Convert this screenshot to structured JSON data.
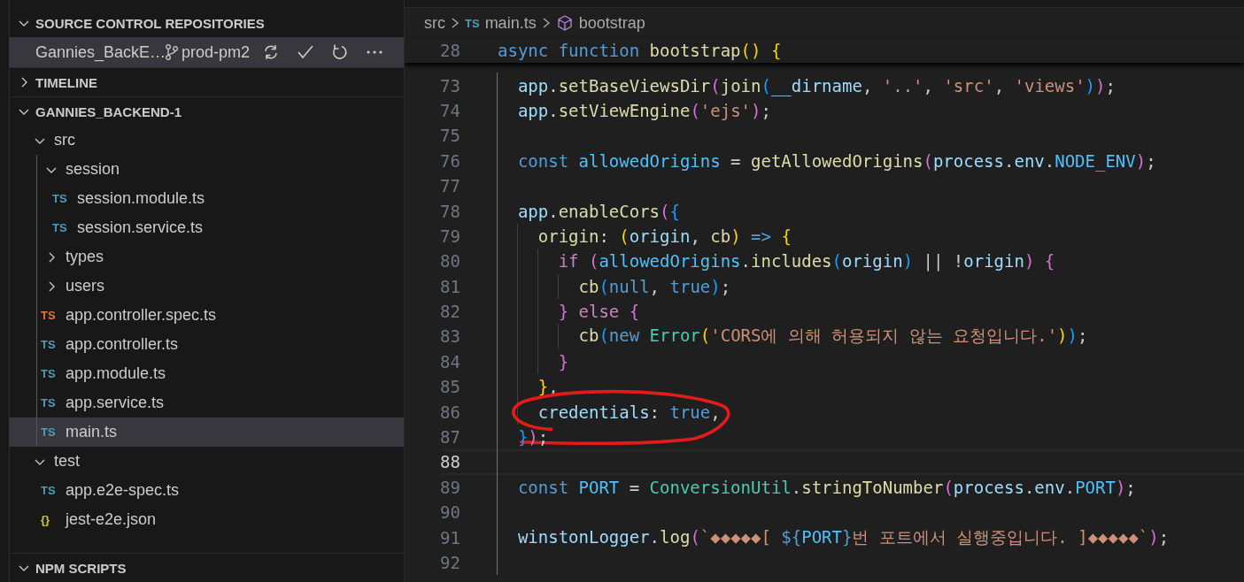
{
  "sidebar": {
    "sections": [
      {
        "kind": "repos",
        "title": "SOURCE CONTROL REPOSITORIES",
        "expanded": true,
        "repositories": [
          {
            "name": "Gannies_BackE…",
            "branch": "prod-pm2",
            "selected": true
          }
        ]
      },
      {
        "kind": "timeline",
        "title": "TIMELINE",
        "expanded": false
      },
      {
        "kind": "explorer",
        "title": "GANNIES_BACKEND-1",
        "expanded": true,
        "tree": [
          {
            "kind": "folder",
            "label": "src",
            "expanded": true,
            "selected": false,
            "children": [
              {
                "kind": "folder",
                "label": "session",
                "expanded": true,
                "selected": false,
                "children": [
                  {
                    "kind": "file",
                    "label": "session.module.ts",
                    "icon": "TS",
                    "color": "#519aba",
                    "selected": false
                  },
                  {
                    "kind": "file",
                    "label": "session.service.ts",
                    "icon": "TS",
                    "color": "#519aba",
                    "selected": false
                  }
                ]
              },
              {
                "kind": "folder",
                "label": "types",
                "expanded": false,
                "selected": false
              },
              {
                "kind": "folder",
                "label": "users",
                "expanded": false,
                "selected": false
              },
              {
                "kind": "file",
                "label": "app.controller.spec.ts",
                "icon": "TS",
                "color": "#e37933",
                "selected": false
              },
              {
                "kind": "file",
                "label": "app.controller.ts",
                "icon": "TS",
                "color": "#519aba",
                "selected": false
              },
              {
                "kind": "file",
                "label": "app.module.ts",
                "icon": "TS",
                "color": "#519aba",
                "selected": false
              },
              {
                "kind": "file",
                "label": "app.service.ts",
                "icon": "TS",
                "color": "#519aba",
                "selected": false
              },
              {
                "kind": "file",
                "label": "main.ts",
                "icon": "TS",
                "color": "#519aba",
                "selected": true
              }
            ]
          },
          {
            "kind": "folder",
            "label": "test",
            "expanded": true,
            "selected": false,
            "children": [
              {
                "kind": "file",
                "label": "app.e2e-spec.ts",
                "icon": "TS",
                "color": "#519aba",
                "selected": false
              },
              {
                "kind": "file",
                "label": "jest-e2e.json",
                "icon": "{}",
                "color": "#cbcb41",
                "selected": false
              }
            ]
          }
        ]
      },
      {
        "kind": "npm",
        "title": "NPM SCRIPTS",
        "expanded": true
      }
    ]
  },
  "editor": {
    "breadcrumb": [
      {
        "kind": "folder",
        "label": "src"
      },
      {
        "kind": "file",
        "label": "main.ts",
        "icon": "TS",
        "color": "#519aba"
      },
      {
        "kind": "symbol",
        "label": "bootstrap"
      }
    ],
    "sticky": {
      "number": "28",
      "tokens": [
        {
          "kind": "kw",
          "text": "async "
        },
        {
          "kind": "kw",
          "text": "function "
        },
        {
          "kind": "fn",
          "text": "bootstrap"
        },
        {
          "kind": "b1",
          "text": "() "
        },
        {
          "kind": "b1",
          "text": "{"
        }
      ]
    },
    "lines": [
      {
        "number": "73",
        "current": false,
        "circled": false,
        "tokens": [
          {
            "kind": "var",
            "text": "  app"
          },
          {
            "kind": "p",
            "text": "."
          },
          {
            "kind": "fn",
            "text": "setBaseViewsDir"
          },
          {
            "kind": "b2",
            "text": "("
          },
          {
            "kind": "fn",
            "text": "join"
          },
          {
            "kind": "b3",
            "text": "("
          },
          {
            "kind": "var",
            "text": "__dirname"
          },
          {
            "kind": "p",
            "text": ", "
          },
          {
            "kind": "str",
            "text": "'..'"
          },
          {
            "kind": "p",
            "text": ", "
          },
          {
            "kind": "str",
            "text": "'src'"
          },
          {
            "kind": "p",
            "text": ", "
          },
          {
            "kind": "str",
            "text": "'views'"
          },
          {
            "kind": "b3",
            "text": ")"
          },
          {
            "kind": "b2",
            "text": ")"
          },
          {
            "kind": "p",
            "text": ";"
          }
        ]
      },
      {
        "number": "74",
        "current": false,
        "circled": false,
        "tokens": [
          {
            "kind": "var",
            "text": "  app"
          },
          {
            "kind": "p",
            "text": "."
          },
          {
            "kind": "fn",
            "text": "setViewEngine"
          },
          {
            "kind": "b2",
            "text": "("
          },
          {
            "kind": "str",
            "text": "'ejs'"
          },
          {
            "kind": "b2",
            "text": ")"
          },
          {
            "kind": "p",
            "text": ";"
          }
        ]
      },
      {
        "number": "75",
        "current": false
      },
      {
        "number": "76",
        "current": false,
        "circled": false,
        "tokens": [
          {
            "kind": "kw",
            "text": "  const "
          },
          {
            "kind": "const",
            "text": "allowedOrigins"
          },
          {
            "kind": "p",
            "text": " = "
          },
          {
            "kind": "fn",
            "text": "getAllowedOrigins"
          },
          {
            "kind": "b2",
            "text": "("
          },
          {
            "kind": "var",
            "text": "process"
          },
          {
            "kind": "p",
            "text": "."
          },
          {
            "kind": "var",
            "text": "env"
          },
          {
            "kind": "p",
            "text": "."
          },
          {
            "kind": "const",
            "text": "NODE_ENV"
          },
          {
            "kind": "b2",
            "text": ")"
          },
          {
            "kind": "p",
            "text": ";"
          }
        ]
      },
      {
        "number": "77",
        "current": false
      },
      {
        "number": "78",
        "current": false,
        "circled": false,
        "tokens": [
          {
            "kind": "var",
            "text": "  app"
          },
          {
            "kind": "p",
            "text": "."
          },
          {
            "kind": "fn",
            "text": "enableCors"
          },
          {
            "kind": "b2",
            "text": "("
          },
          {
            "kind": "b3",
            "text": "{"
          }
        ]
      },
      {
        "number": "79",
        "current": false,
        "circled": false,
        "tokens": [
          {
            "kind": "fn",
            "text": "    origin"
          },
          {
            "kind": "p",
            "text": ": "
          },
          {
            "kind": "b1",
            "text": "("
          },
          {
            "kind": "var",
            "text": "origin"
          },
          {
            "kind": "p",
            "text": ", "
          },
          {
            "kind": "fn",
            "text": "cb"
          },
          {
            "kind": "b1",
            "text": ") "
          },
          {
            "kind": "kw",
            "text": "=> "
          },
          {
            "kind": "b1",
            "text": "{"
          }
        ]
      },
      {
        "number": "80",
        "current": false,
        "circled": false,
        "tokens": [
          {
            "kind": "ctl",
            "text": "      if "
          },
          {
            "kind": "b2",
            "text": "("
          },
          {
            "kind": "const",
            "text": "allowedOrigins"
          },
          {
            "kind": "p",
            "text": "."
          },
          {
            "kind": "fn",
            "text": "includes"
          },
          {
            "kind": "b3",
            "text": "("
          },
          {
            "kind": "var",
            "text": "origin"
          },
          {
            "kind": "b3",
            "text": ")"
          },
          {
            "kind": "p",
            "text": " || !"
          },
          {
            "kind": "var",
            "text": "origin"
          },
          {
            "kind": "b2",
            "text": ") "
          },
          {
            "kind": "b2",
            "text": "{"
          }
        ]
      },
      {
        "number": "81",
        "current": false,
        "circled": false,
        "tokens": [
          {
            "kind": "fn",
            "text": "        cb"
          },
          {
            "kind": "b3",
            "text": "("
          },
          {
            "kind": "kw",
            "text": "null"
          },
          {
            "kind": "p",
            "text": ", "
          },
          {
            "kind": "kw",
            "text": "true"
          },
          {
            "kind": "b3",
            "text": ")"
          },
          {
            "kind": "p",
            "text": ";"
          }
        ]
      },
      {
        "number": "82",
        "current": false,
        "circled": false,
        "tokens": [
          {
            "kind": "b2",
            "text": "      } "
          },
          {
            "kind": "ctl",
            "text": "else "
          },
          {
            "kind": "b2",
            "text": "{"
          }
        ]
      },
      {
        "number": "83",
        "current": false,
        "circled": false,
        "tokens": [
          {
            "kind": "fn",
            "text": "        cb"
          },
          {
            "kind": "b3",
            "text": "("
          },
          {
            "kind": "kw",
            "text": "new "
          },
          {
            "kind": "cls",
            "text": "Error"
          },
          {
            "kind": "b1",
            "text": "("
          },
          {
            "kind": "str",
            "text": "'CORS에 의해 허용되지 않는 요청입니다.'"
          },
          {
            "kind": "b1",
            "text": ")"
          },
          {
            "kind": "b3",
            "text": ")"
          },
          {
            "kind": "p",
            "text": ";"
          }
        ]
      },
      {
        "number": "84",
        "current": false,
        "circled": false,
        "tokens": [
          {
            "kind": "b2",
            "text": "      }"
          }
        ]
      },
      {
        "number": "85",
        "current": false,
        "circled": false,
        "tokens": [
          {
            "kind": "b1",
            "text": "    }"
          },
          {
            "kind": "p",
            "text": ","
          }
        ]
      },
      {
        "number": "86",
        "current": false,
        "circled": true,
        "tokens": [
          {
            "kind": "var",
            "text": "    credentials"
          },
          {
            "kind": "p",
            "text": ": "
          },
          {
            "kind": "kw",
            "text": "true"
          },
          {
            "kind": "p",
            "text": ","
          }
        ]
      },
      {
        "number": "87",
        "current": false,
        "circled": false,
        "tokens": [
          {
            "kind": "b3",
            "text": "  }"
          },
          {
            "kind": "b2",
            "text": ")"
          },
          {
            "kind": "p",
            "text": ";"
          }
        ]
      },
      {
        "number": "88",
        "current": true
      },
      {
        "number": "89",
        "current": false,
        "circled": false,
        "tokens": [
          {
            "kind": "kw",
            "text": "  const "
          },
          {
            "kind": "const",
            "text": "PORT"
          },
          {
            "kind": "p",
            "text": " = "
          },
          {
            "kind": "cls",
            "text": "ConversionUtil"
          },
          {
            "kind": "p",
            "text": "."
          },
          {
            "kind": "fn",
            "text": "stringToNumber"
          },
          {
            "kind": "b2",
            "text": "("
          },
          {
            "kind": "var",
            "text": "process"
          },
          {
            "kind": "p",
            "text": "."
          },
          {
            "kind": "var",
            "text": "env"
          },
          {
            "kind": "p",
            "text": "."
          },
          {
            "kind": "const",
            "text": "PORT"
          },
          {
            "kind": "b2",
            "text": ")"
          },
          {
            "kind": "p",
            "text": ";"
          }
        ]
      },
      {
        "number": "90",
        "current": false
      },
      {
        "number": "91",
        "current": false,
        "circled": false,
        "tokens": [
          {
            "kind": "var",
            "text": "  winstonLogger"
          },
          {
            "kind": "p",
            "text": "."
          },
          {
            "kind": "fn",
            "text": "log"
          },
          {
            "kind": "b2",
            "text": "("
          },
          {
            "kind": "str",
            "text": "`◆◆◆◆◆[ "
          },
          {
            "kind": "kw",
            "text": "${"
          },
          {
            "kind": "const",
            "text": "PORT"
          },
          {
            "kind": "kw",
            "text": "}"
          },
          {
            "kind": "str",
            "text": "번 포트에서 실행중입니다. ]◆◆◆◆◆`"
          },
          {
            "kind": "b2",
            "text": ")"
          },
          {
            "kind": "p",
            "text": ";"
          }
        ]
      },
      {
        "number": "92",
        "current": false
      }
    ]
  }
}
